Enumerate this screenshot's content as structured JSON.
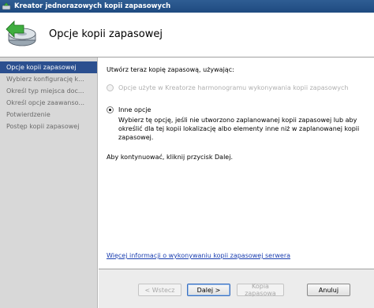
{
  "window": {
    "title": "Kreator jednorazowych kopii zapasowych",
    "icon": "backup-icon"
  },
  "header": {
    "title": "Opcje kopii zapasowej",
    "icon": "backup-wizard-icon"
  },
  "sidebar": {
    "items": [
      {
        "label": "Opcje kopii zapasowej",
        "active": true
      },
      {
        "label": "Wybierz konfigurację k...",
        "active": false
      },
      {
        "label": "Określ typ miejsca doc...",
        "active": false
      },
      {
        "label": "Określ opcje zaawanso...",
        "active": false
      },
      {
        "label": "Potwierdzenie",
        "active": false
      },
      {
        "label": "Postęp kopii zapasowej",
        "active": false
      }
    ]
  },
  "content": {
    "lead": "Utwórz teraz kopię zapasową, używając:",
    "option_scheduled": {
      "label": "Opcje użyte w Kreatorze harmonogramu wykonywania kopii zapasowych",
      "enabled": false,
      "checked": false
    },
    "option_other": {
      "label": "Inne opcje",
      "enabled": true,
      "checked": true,
      "description": "Wybierz tę opcję, jeśli nie utworzono zaplanowanej kopii zapasowej lub aby określić dla tej kopii lokalizację albo elementy inne niż w zaplanowanej kopii zapasowej."
    },
    "continue_text": "Aby kontynuować, kliknij przycisk Dalej.",
    "more_info_link": "Więcej informacji o wykonywaniu kopii zapasowej serwera"
  },
  "footer": {
    "back_label": "< Wstecz",
    "next_label": "Dalej >",
    "backup_label": "Kopia zapasowa",
    "cancel_label": "Anuluj"
  },
  "colors": {
    "titlebar": "#2f5d93",
    "sidebar_bg": "#d8d8d8",
    "sidebar_active": "#2b4f8f",
    "link": "#1a3eb0"
  }
}
